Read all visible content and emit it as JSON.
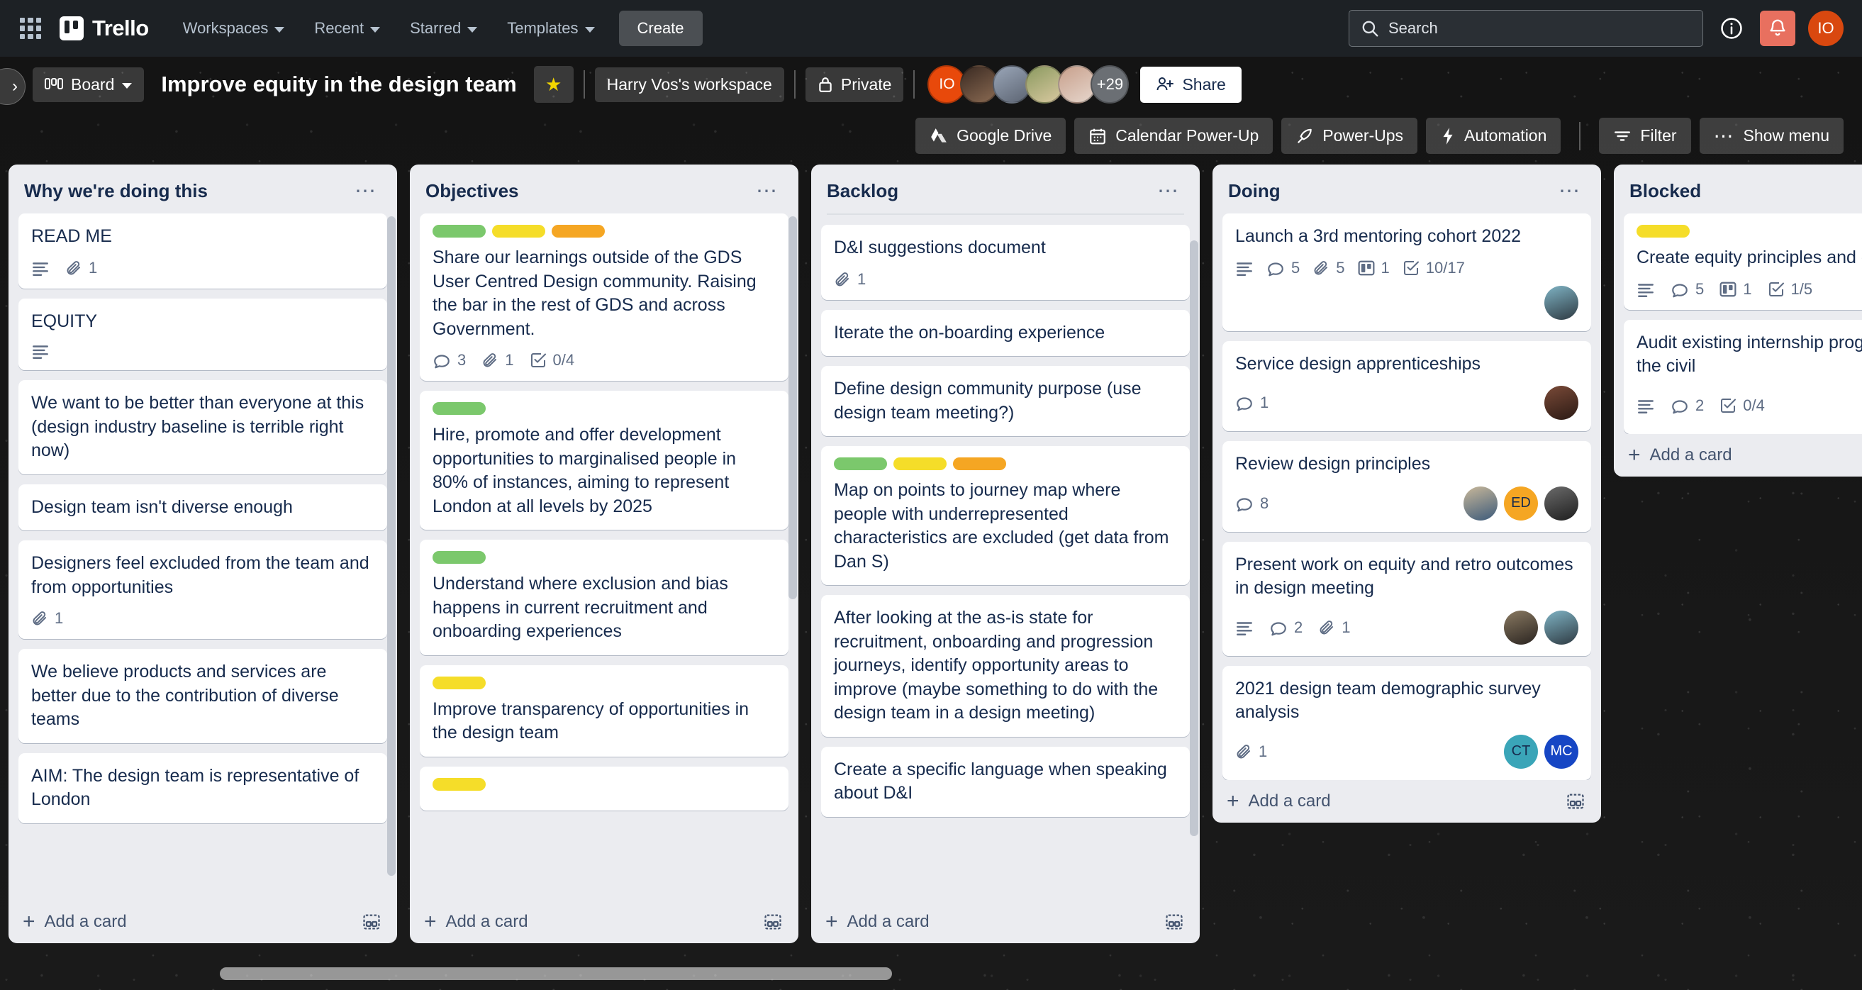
{
  "topnav": {
    "apps_icon": "grid-apps-icon",
    "brand": "Trello",
    "items": [
      {
        "label": "Workspaces",
        "caret": true
      },
      {
        "label": "Recent",
        "caret": true
      },
      {
        "label": "Starred",
        "caret": true
      },
      {
        "label": "Templates",
        "caret": true
      }
    ],
    "create_label": "Create",
    "search_placeholder": "Search",
    "info_icon": "info-icon",
    "notifications_icon": "bell-icon",
    "user_initials": "IO",
    "user_color": "#d9480f",
    "notification_color": "#e8705f"
  },
  "board_header": {
    "collapse_icon": "chevron-right-icon",
    "view_label": "Board",
    "view_icon": "board-view-icon",
    "title": "Improve equity in the design team",
    "star_icon": "star-icon",
    "workspace": "Harry Vos's workspace",
    "visibility": "Private",
    "visibility_icon": "lock-icon",
    "members": [
      {
        "initials": "IO",
        "color": "#e8490b",
        "type": "initials"
      },
      {
        "initials": "",
        "color": "#6b4a3a",
        "type": "photo"
      },
      {
        "initials": "",
        "color": "#8a93a6",
        "type": "photo"
      },
      {
        "initials": "",
        "color": "#6c7a50",
        "type": "photo"
      },
      {
        "initials": "",
        "color": "#b08b7a",
        "type": "photo"
      }
    ],
    "overflow_count": "+29",
    "share_label": "Share",
    "share_icon": "person-add-icon"
  },
  "powerbar": {
    "items": [
      {
        "label": "Google Drive",
        "icon": "google-drive-icon"
      },
      {
        "label": "Calendar Power-Up",
        "icon": "calendar-icon"
      },
      {
        "label": "Power-Ups",
        "icon": "rocket-icon"
      },
      {
        "label": "Automation",
        "icon": "lightning-icon"
      },
      {
        "label": "Filter",
        "icon": "filter-icon"
      },
      {
        "label": "Show menu",
        "icon": "ellipsis-icon"
      }
    ]
  },
  "add_card_label": "Add a card",
  "label_colors": {
    "green": "#7bc86c",
    "yellow": "#f5dd29",
    "orange": "#f5a623"
  },
  "lists": [
    {
      "title": "Why we're doing this",
      "cards": [
        {
          "title": "READ ME",
          "labels": [],
          "badges": [
            {
              "icon": "description-icon",
              "text": ""
            },
            {
              "icon": "attachment-icon",
              "text": "1"
            }
          ],
          "members": []
        },
        {
          "title": "EQUITY",
          "labels": [],
          "badges": [
            {
              "icon": "description-icon",
              "text": ""
            }
          ],
          "members": []
        },
        {
          "title": "We want to be better than everyone at this (design industry baseline is terrible right now)",
          "labels": [],
          "badges": [],
          "members": []
        },
        {
          "title": "Design team isn't diverse enough",
          "labels": [],
          "badges": [],
          "members": []
        },
        {
          "title": "Designers feel excluded from the team and from opportunities",
          "labels": [],
          "badges": [
            {
              "icon": "attachment-icon",
              "text": "1"
            }
          ],
          "members": []
        },
        {
          "title": "We believe products and services are better due to the contribution of diverse teams",
          "labels": [],
          "badges": [],
          "members": []
        },
        {
          "title": "AIM: The design team is representative of London",
          "labels": [],
          "badges": [],
          "members": []
        }
      ]
    },
    {
      "title": "Objectives",
      "cards": [
        {
          "title": "Share our learnings outside of the GDS User Centred Design community. Raising the bar in the rest of GDS and across Government.",
          "labels": [
            "green",
            "yellow",
            "orange"
          ],
          "badges": [
            {
              "icon": "comment-icon",
              "text": "3"
            },
            {
              "icon": "attachment-icon",
              "text": "1"
            },
            {
              "icon": "checklist-icon",
              "text": "0/4"
            }
          ],
          "members": []
        },
        {
          "title": "Hire, promote and offer development opportunities to marginalised people in 80% of instances, aiming to represent London at all levels by 2025",
          "labels": [
            "green"
          ],
          "badges": [],
          "members": []
        },
        {
          "title": "Understand where exclusion and bias happens in current recruitment and onboarding experiences",
          "labels": [
            "green"
          ],
          "badges": [],
          "members": []
        },
        {
          "title": "Improve transparency of opportunities in the design team",
          "labels": [
            "yellow"
          ],
          "badges": [],
          "members": []
        },
        {
          "title": "",
          "labels": [
            "yellow"
          ],
          "badges": [],
          "members": []
        }
      ]
    },
    {
      "title": "Backlog",
      "cards": [
        {
          "title": "D&I suggestions document",
          "labels": [],
          "badges": [
            {
              "icon": "attachment-icon",
              "text": "1"
            }
          ],
          "members": []
        },
        {
          "title": "Iterate the on-boarding experience",
          "labels": [],
          "badges": [],
          "members": []
        },
        {
          "title": "Define design community purpose (use design team meeting?)",
          "labels": [],
          "badges": [],
          "members": []
        },
        {
          "title": "Map on points to journey map where people with underrepresented characteristics are excluded (get data from Dan S)",
          "labels": [
            "green",
            "yellow",
            "orange"
          ],
          "badges": [],
          "members": []
        },
        {
          "title": "After looking at the as-is state for recruitment, onboarding and progression journeys, identify opportunity areas to improve (maybe something to do with the design team in a design meeting)",
          "labels": [],
          "badges": [],
          "members": []
        },
        {
          "title": "Create a specific language when speaking about D&I",
          "labels": [],
          "badges": [],
          "members": []
        }
      ]
    },
    {
      "title": "Doing",
      "cards": [
        {
          "title": "Launch a 3rd mentoring cohort 2022",
          "labels": [],
          "badges": [
            {
              "icon": "description-icon",
              "text": ""
            },
            {
              "icon": "comment-icon",
              "text": "5"
            },
            {
              "icon": "attachment-icon",
              "text": "5"
            },
            {
              "icon": "board-icon",
              "text": "1"
            },
            {
              "icon": "checklist-icon",
              "text": "10/17"
            }
          ],
          "members": [
            {
              "initials": "",
              "color": "#5b7a86",
              "type": "photo"
            }
          ]
        },
        {
          "title": "Service design apprenticeships",
          "labels": [],
          "badges": [
            {
              "icon": "comment-icon",
              "text": "1"
            }
          ],
          "members": [
            {
              "initials": "",
              "color": "#4a2f28",
              "type": "photo"
            }
          ]
        },
        {
          "title": "Review design principles",
          "labels": [],
          "badges": [
            {
              "icon": "comment-icon",
              "text": "8"
            }
          ],
          "members": [
            {
              "initials": "",
              "color": "#7d93a8",
              "type": "photo"
            },
            {
              "initials": "ED",
              "color": "#f5a623",
              "type": "initials"
            },
            {
              "initials": "",
              "color": "#4a4a4a",
              "type": "photo"
            }
          ]
        },
        {
          "title": "Present work on equity and retro outcomes in design meeting",
          "labels": [],
          "badges": [
            {
              "icon": "description-icon",
              "text": ""
            },
            {
              "icon": "comment-icon",
              "text": "2"
            },
            {
              "icon": "attachment-icon",
              "text": "1"
            }
          ],
          "members": [
            {
              "initials": "",
              "color": "#5a4c42",
              "type": "photo"
            },
            {
              "initials": "",
              "color": "#5b7a86",
              "type": "photo"
            }
          ]
        },
        {
          "title": "2021 design team demographic survey analysis",
          "labels": [],
          "badges": [
            {
              "icon": "attachment-icon",
              "text": "1"
            }
          ],
          "members": [
            {
              "initials": "CT",
              "color": "#3aa5b8",
              "type": "initials"
            },
            {
              "initials": "MC",
              "color": "#1646c4",
              "type": "initials"
            }
          ]
        }
      ]
    },
    {
      "title": "Blocked",
      "cards": [
        {
          "title": "Create equity principles and conduct",
          "labels": [
            "yellow"
          ],
          "badges": [
            {
              "icon": "description-icon",
              "text": ""
            },
            {
              "icon": "comment-icon",
              "text": "5"
            },
            {
              "icon": "board-icon",
              "text": "1"
            },
            {
              "icon": "checklist-icon",
              "text": "1/5"
            }
          ],
          "members": []
        },
        {
          "title": "Audit existing internship programmes within the civil",
          "labels": [],
          "badges": [
            {
              "icon": "description-icon",
              "text": ""
            },
            {
              "icon": "comment-icon",
              "text": "2"
            },
            {
              "icon": "checklist-icon",
              "text": "0/4"
            }
          ],
          "members": [
            {
              "initials": "",
              "color": "#a8d8c8",
              "type": "photo"
            }
          ]
        }
      ]
    }
  ]
}
